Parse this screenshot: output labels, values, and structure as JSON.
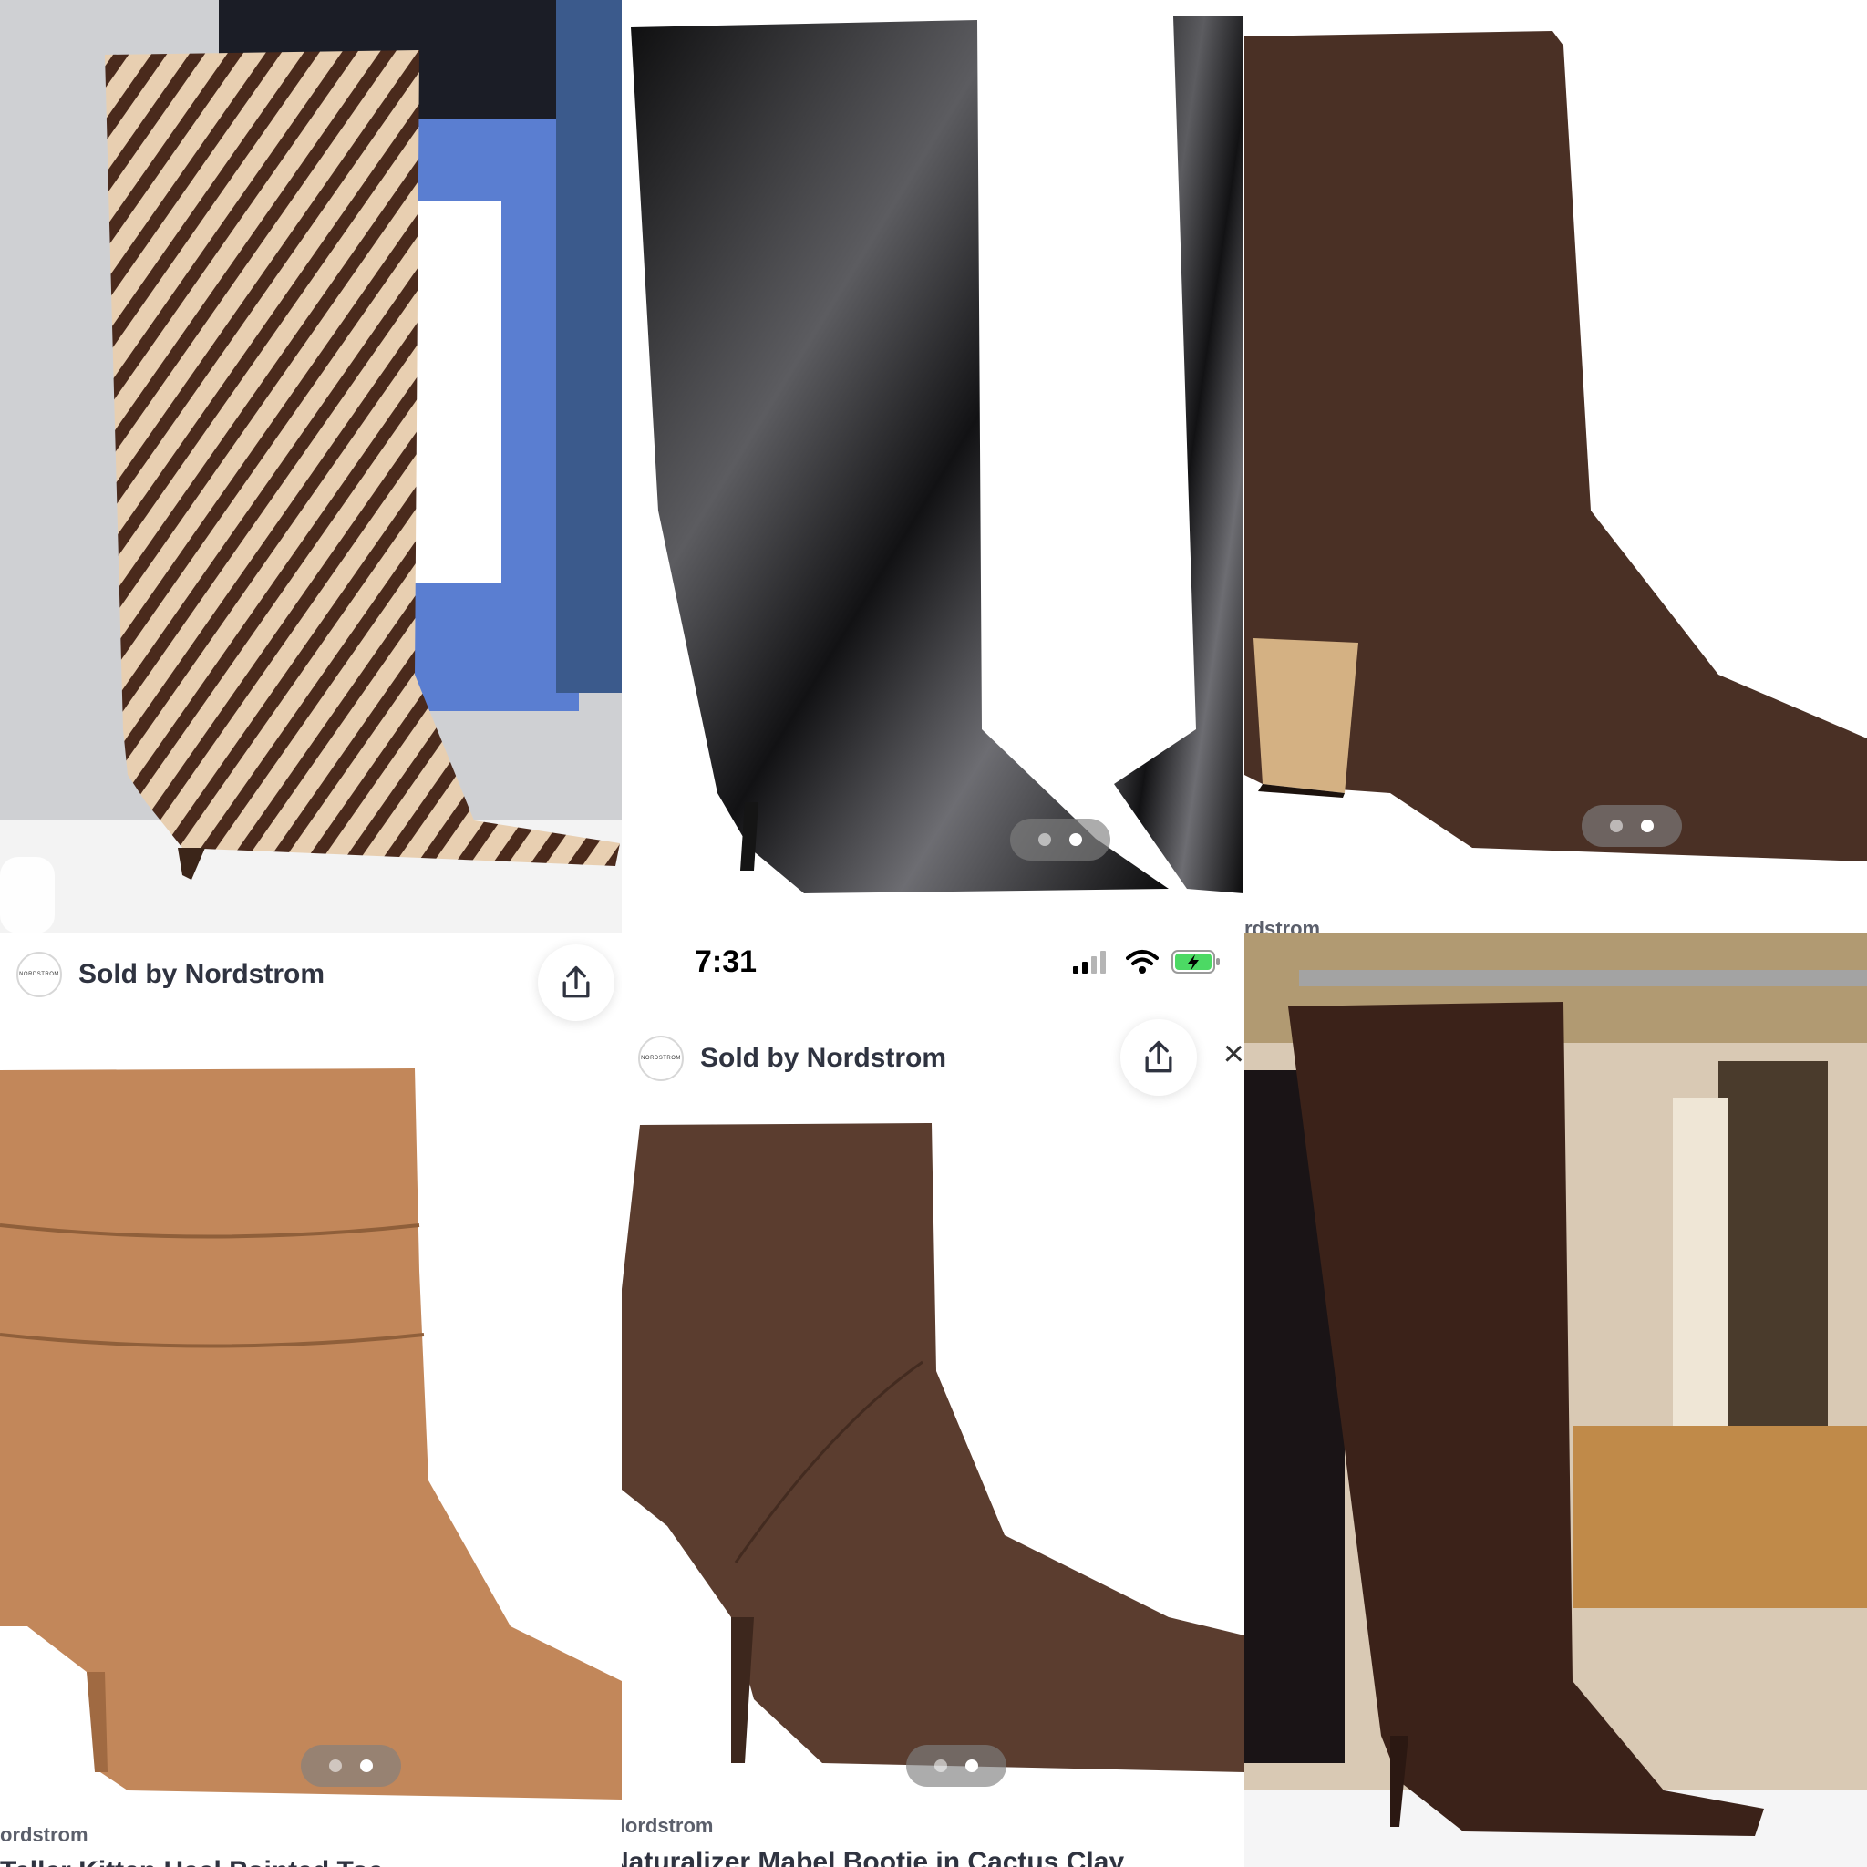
{
  "tiles": {
    "tile_2": {
      "carousel": {
        "total": 2,
        "active": 2
      }
    },
    "tile_3": {
      "carousel": {
        "total": 2,
        "active": 2
      },
      "partial_brand": "rdstrom"
    },
    "tile_4": {
      "seller": {
        "name": "Sold by Nordstrom",
        "logo_text": "NORDSTROM"
      },
      "carousel": {
        "total": 2,
        "active": 2
      },
      "brand_label": "ordstrom",
      "partial_title": "Teller Kitten Heel Pointed Toe"
    },
    "tile_5": {
      "status_bar": {
        "time": "7:31"
      },
      "seller": {
        "name": "Sold by Nordstrom",
        "logo_text": "NORDSTROM"
      },
      "carousel": {
        "total": 2,
        "active": 2
      },
      "brand_label": "Nordstrom",
      "product_title": "Naturalizer Mabel Bootie in Cactus Clay"
    }
  },
  "icons": {
    "share": "share-icon",
    "close": "close-icon",
    "signal": "cellular-signal-icon",
    "wifi": "wifi-icon",
    "battery": "battery-charging-icon"
  },
  "colors": {
    "seller_text": "#2f3340",
    "battery_green": "#4cd964",
    "dots_bg": "#8a8a8a"
  }
}
